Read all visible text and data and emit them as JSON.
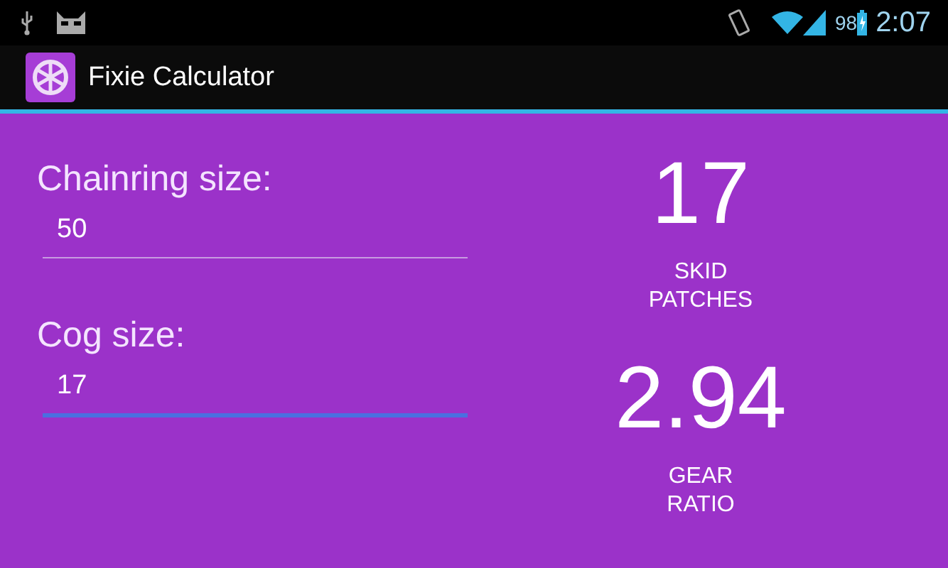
{
  "status_bar": {
    "battery": "98",
    "time": "2:07"
  },
  "app_bar": {
    "title": "Fixie Calculator"
  },
  "fields": [
    {
      "label": "Chainring size:",
      "value": "50",
      "focused": false
    },
    {
      "label": "Cog size:",
      "value": "17",
      "focused": true
    }
  ],
  "results": [
    {
      "value": "17",
      "caption": "SKID PATCHES"
    },
    {
      "value": "2.94",
      "caption": "GEAR RATIO"
    }
  ]
}
